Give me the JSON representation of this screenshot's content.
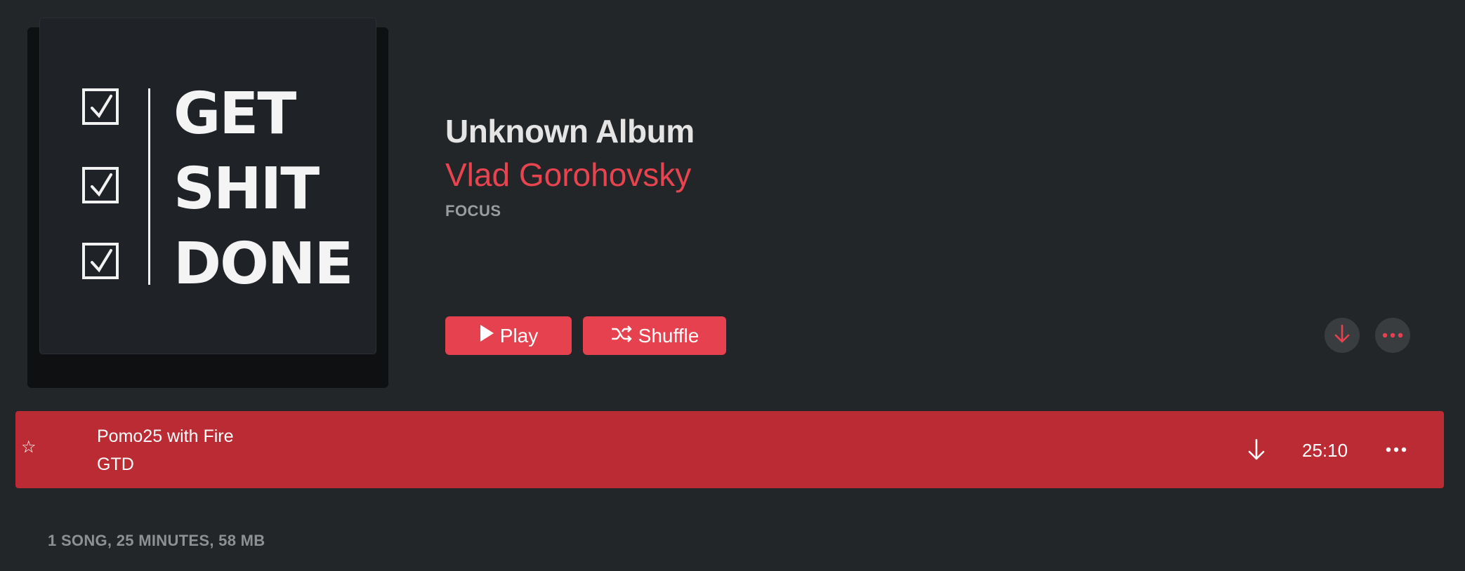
{
  "album": {
    "title": "Unknown Album",
    "artist": "Vlad Gorohovsky",
    "genre": "FOCUS",
    "artwork_lines": [
      "GET",
      "SHIT",
      "DONE"
    ]
  },
  "actions": {
    "play_label": "Play",
    "shuffle_label": "Shuffle",
    "download_icon": "download-arrow-icon",
    "more_icon": "more-ellipsis-icon"
  },
  "tracks": [
    {
      "title": "Pomo25 with Fire",
      "artist": "GTD",
      "duration": "25:10",
      "favorite_icon": "star-outline-icon",
      "selected": true
    }
  ],
  "summary": "1 SONG, 25 MINUTES, 58 MB",
  "colors": {
    "background": "#232628",
    "accent": "#e5414e",
    "selected_row": "#bb2b33",
    "artist_text": "#e8444f",
    "secondary_text": "#9a9d9f"
  }
}
